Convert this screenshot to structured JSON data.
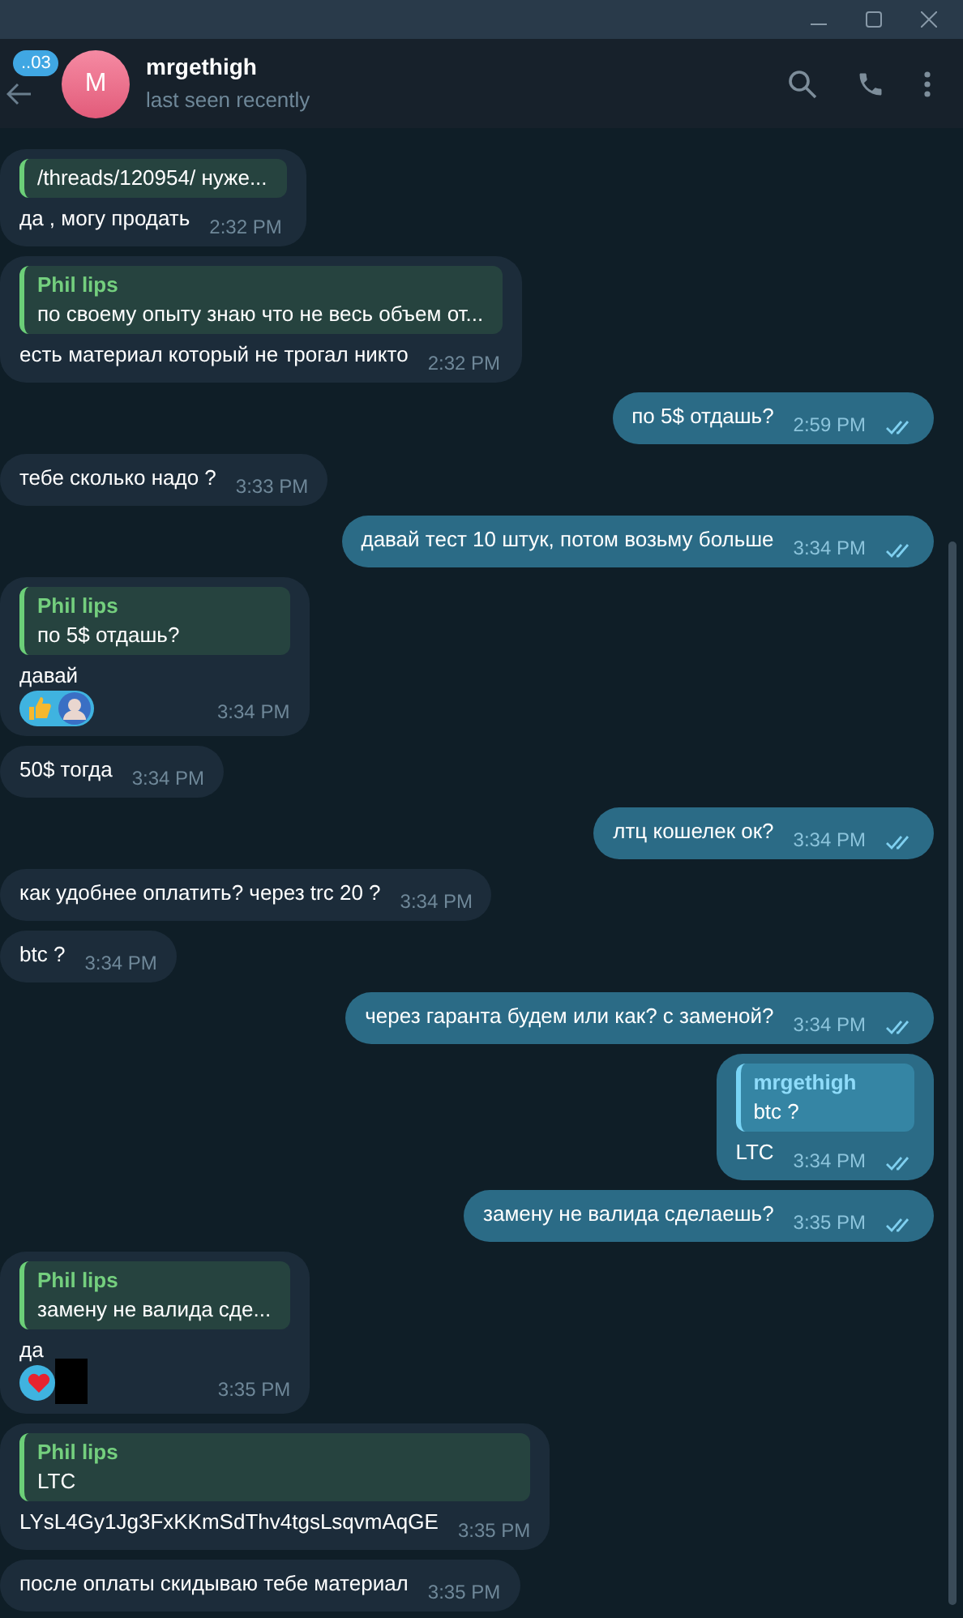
{
  "header": {
    "badge": "..03",
    "avatar_letter": "M",
    "name": "mrgethigh",
    "status": "last seen recently"
  },
  "messages": [
    {
      "kind": "incoming",
      "quote": {
        "text": "/threads/120954/ нуже..."
      },
      "text": "да , могу продать",
      "time": "2:32 PM"
    },
    {
      "kind": "incoming",
      "quote": {
        "name": "Phil lips",
        "text": "по своему опыту знаю что не весь объем от..."
      },
      "text": "есть материал который не трогал никто",
      "time": "2:32 PM"
    },
    {
      "kind": "outgoing",
      "text": "по 5$ отдашь?",
      "time": "2:59 PM",
      "read": true
    },
    {
      "kind": "incoming",
      "text": "тебе сколько надо ?",
      "time": "3:33 PM"
    },
    {
      "kind": "outgoing",
      "text": "давай тест 10 штук, потом возьму больше",
      "time": "3:34 PM",
      "read": true
    },
    {
      "kind": "incoming",
      "quote": {
        "name": "Phil lips",
        "text": "по 5$ отдашь?"
      },
      "text": "давай",
      "time": "3:34 PM",
      "reaction": {
        "kind": "thumbs-up",
        "avatar": {
          "kind": "person"
        }
      }
    },
    {
      "kind": "incoming",
      "text": "50$ тогда",
      "time": "3:34 PM"
    },
    {
      "kind": "outgoing",
      "text": "лтц кошелек ок?",
      "time": "3:34 PM",
      "read": true
    },
    {
      "kind": "incoming",
      "text": "как удобнее оплатить? через trc 20 ?",
      "time": "3:34 PM"
    },
    {
      "kind": "incoming",
      "text": "btc ?",
      "time": "3:34 PM"
    },
    {
      "kind": "outgoing",
      "text": "через гаранта будем или как? с заменой?",
      "time": "3:34 PM",
      "read": true
    },
    {
      "kind": "outgoing",
      "quote": {
        "name": "mrgethigh",
        "text": "btc ?"
      },
      "text": "LTC",
      "time": "3:34 PM",
      "read": true
    },
    {
      "kind": "outgoing",
      "text": "замену не валида сделаешь?",
      "time": "3:35 PM",
      "read": true
    },
    {
      "kind": "incoming",
      "quote": {
        "name": "Phil lips",
        "text": "замену не валида сде..."
      },
      "text": "да",
      "time": "3:35 PM",
      "reaction": {
        "kind": "heart",
        "avatar": {
          "kind": "redacted"
        }
      }
    },
    {
      "kind": "incoming",
      "quote": {
        "name": "Phil lips",
        "text": "LTC"
      },
      "text": "LYsL4Gy1Jg3FxKKmSdThv4tgsLsqvmAqGE",
      "time": "3:35 PM"
    },
    {
      "kind": "incoming",
      "text": "после оплаты скидываю тебе материал",
      "time": "3:35 PM"
    }
  ]
}
